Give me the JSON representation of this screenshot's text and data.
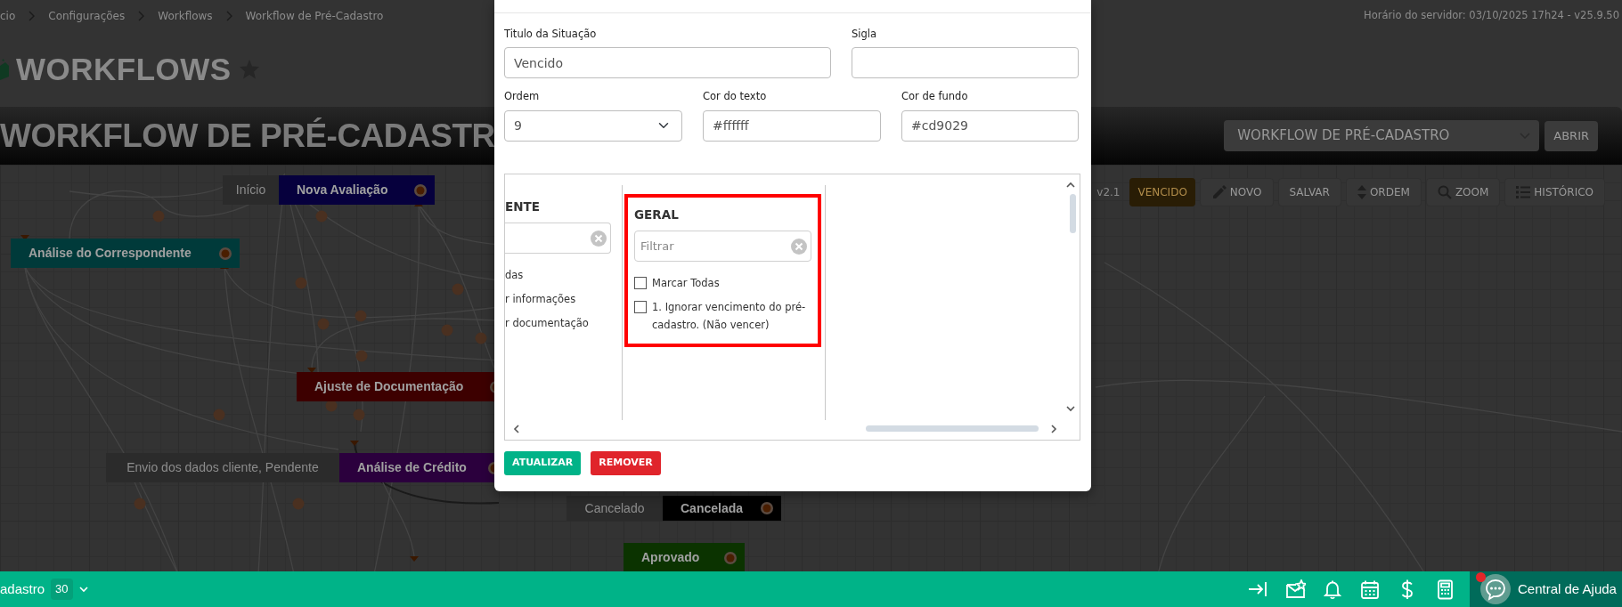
{
  "breadcrumb": [
    "cio",
    "Configurações",
    "Workflows",
    "Workflow de Pré-Cadastro"
  ],
  "server_info": "Horário do servidor: 03/10/2025 17h24 - v25.9.50",
  "page_title": "WORKFLOWS",
  "workflow_header": {
    "title": "WORKFLOW DE PRÉ-CADASTR",
    "select_value": "WORKFLOW DE PRÉ-CADASTRO",
    "open_button": "ABRIR"
  },
  "toolbar": {
    "version": "v2.1",
    "items": [
      {
        "label": "VENCIDO",
        "kind": "status"
      },
      {
        "label": "NOVO",
        "kind": "button"
      },
      {
        "label": "SALVAR",
        "kind": "button"
      },
      {
        "label": "ORDEM",
        "kind": "button"
      },
      {
        "label": "ZOOM",
        "kind": "button"
      },
      {
        "label": "HISTÓRICO",
        "kind": "button"
      }
    ]
  },
  "nodes": [
    {
      "label": "Nova Avaliação",
      "color": "#06003d",
      "tag": "Início"
    },
    {
      "label": "Análise do Correspondente",
      "color": "#003a3a"
    },
    {
      "label": "Ajuste de Documentação",
      "color": "#3d0000"
    },
    {
      "label": "Análise de Crédito",
      "color": "#2b003d",
      "tag": "Envio dos dados cliente, Pendente"
    },
    {
      "label": "Cancelada",
      "color": "#000000",
      "tag": "Cancelado"
    },
    {
      "label": "Aprovado",
      "color": "#0b3300"
    }
  ],
  "modal": {
    "fields": [
      {
        "label": "Titulo da Situação",
        "value": "Vencido",
        "kind": "text"
      },
      {
        "label": "Sigla",
        "kind": "text"
      },
      {
        "label": "Ordem",
        "value": "9",
        "kind": "select"
      },
      {
        "label": "Cor do texto",
        "value": "#ffffff",
        "kind": "text"
      },
      {
        "label": "Cor de fundo",
        "value": "#cd9029",
        "kind": "text"
      }
    ],
    "permission_groups": [
      {
        "title": "ENTE",
        "cut": true,
        "highlighted": false,
        "items": [
          {
            "label": "das"
          },
          {
            "label": "r informações"
          },
          {
            "label": "r documentação"
          }
        ]
      },
      {
        "title": "GERAL",
        "cut": false,
        "highlighted": true,
        "filter_placeholder": "Filtrar",
        "items": [
          {
            "label": "Marcar Todas",
            "checked": false
          },
          {
            "label": "1. Ignorar vencimento do pré-cadastro. (Não vencer)",
            "checked": false
          }
        ]
      }
    ],
    "buttons": [
      {
        "label": "ATUALIZAR",
        "kind": "primary"
      },
      {
        "label": "REMOVER",
        "kind": "danger"
      }
    ]
  },
  "bottom_bar": {
    "title": "adastro",
    "count": "30",
    "help": "Central de Ajuda",
    "help_notification": true
  }
}
